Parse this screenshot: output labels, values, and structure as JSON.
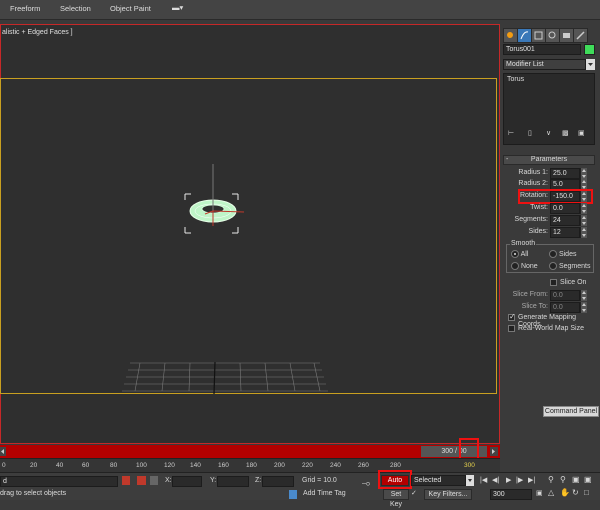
{
  "menu": {
    "tabs": [
      "Freeform",
      "Selection",
      "Object Paint"
    ]
  },
  "viewport": {
    "label": "alistic + Edged Faces ]"
  },
  "command_panel": {
    "object_name": "Torus001",
    "object_color": "#3fdc5a",
    "modifier_list": "Modifier List",
    "stack_items": [
      "Torus"
    ],
    "rollout_title": "Parameters",
    "params": [
      {
        "label": "Radius 1:",
        "value": "25.0"
      },
      {
        "label": "Radius 2:",
        "value": "5.0"
      },
      {
        "label": "Rotation:",
        "value": "-150.0"
      },
      {
        "label": "Twist:",
        "value": "0.0"
      },
      {
        "label": "Segments:",
        "value": "24"
      },
      {
        "label": "Sides:",
        "value": "12"
      }
    ],
    "smooth": {
      "title": "Smooth",
      "options": [
        "All",
        "Sides",
        "None",
        "Segments"
      ],
      "selected": "All"
    },
    "slice_on": "Slice On",
    "slice_from_label": "Slice From:",
    "slice_from_value": "0.0",
    "slice_to_label": "Slice To:",
    "slice_to_value": "0.0",
    "gen_mapping": "Generate Mapping Coords.",
    "real_world": "Real-World Map Size",
    "tooltip": "Command Panel"
  },
  "timeline": {
    "counter": "300 / 00",
    "ticks": [
      "0",
      "20",
      "40",
      "60",
      "80",
      "100",
      "120",
      "140",
      "160",
      "180",
      "200",
      "220",
      "240",
      "260",
      "280",
      "300"
    ],
    "highlight_tick": "300"
  },
  "status": {
    "left_field": "d",
    "prompt": "drag to select objects",
    "x_label": "X:",
    "y_label": "Y:",
    "z_label": "Z:",
    "grid": "Grid = 10.0",
    "add_time_tag": "Add Time Tag",
    "auto_key": "Auto Key",
    "selected": "Selected",
    "set_key": "Set Key",
    "key_filters": "Key Filters...",
    "frame": "300"
  }
}
